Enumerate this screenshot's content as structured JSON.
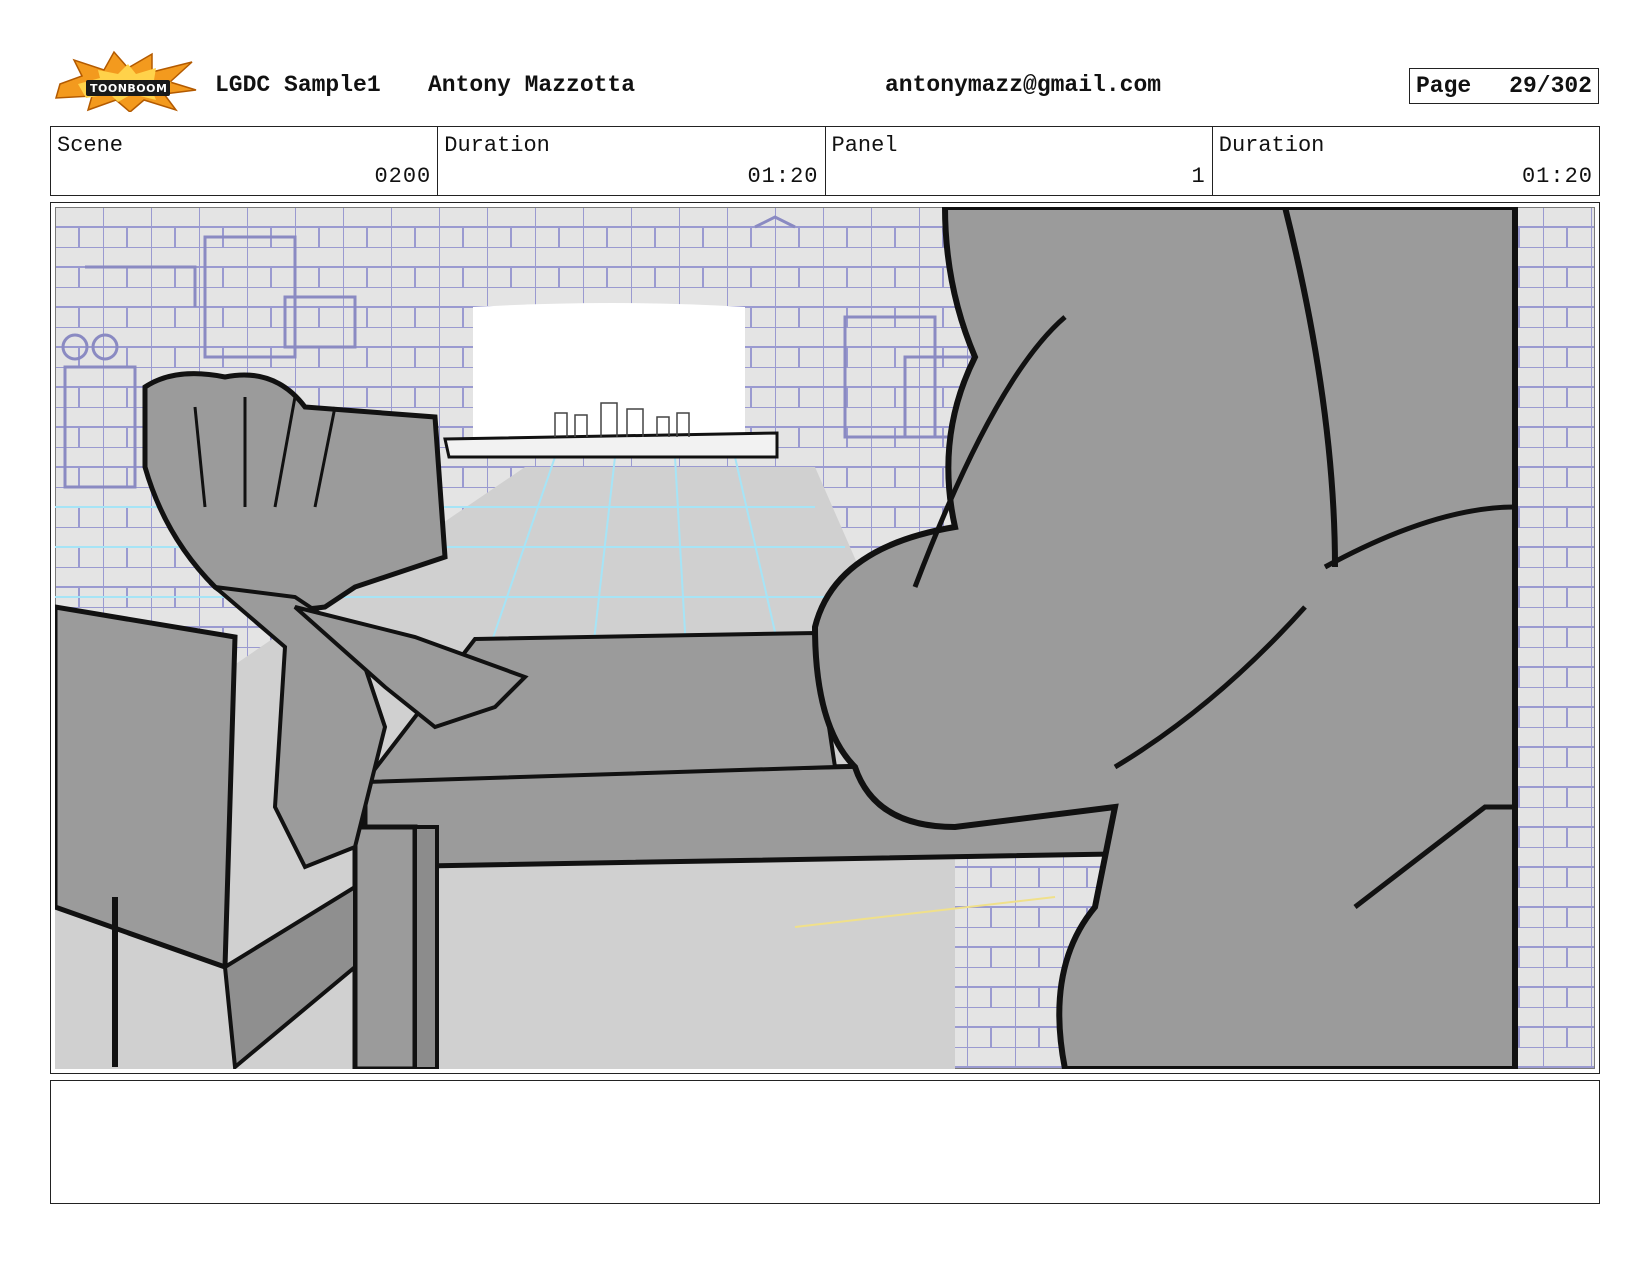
{
  "header": {
    "logo_text": "TOONBOOM",
    "project": "LGDC Sample1",
    "author": "Antony Mazzotta",
    "email": "antonymazz@gmail.com",
    "page_label": "Page",
    "page_value": "29/302"
  },
  "info": {
    "scene_label": "Scene",
    "scene_value": "0200",
    "scene_duration_label": "Duration",
    "scene_duration_value": "01:20",
    "panel_label": "Panel",
    "panel_value": "1",
    "panel_duration_label": "Duration",
    "panel_duration_value": "01:20"
  },
  "notes": {
    "text": ""
  },
  "colors": {
    "background_lines": "#8f8fc4",
    "floor_lines": "#9fe3f5",
    "sketch_fill": "#9b9b9b",
    "logo_burst": "#f39a1e"
  }
}
